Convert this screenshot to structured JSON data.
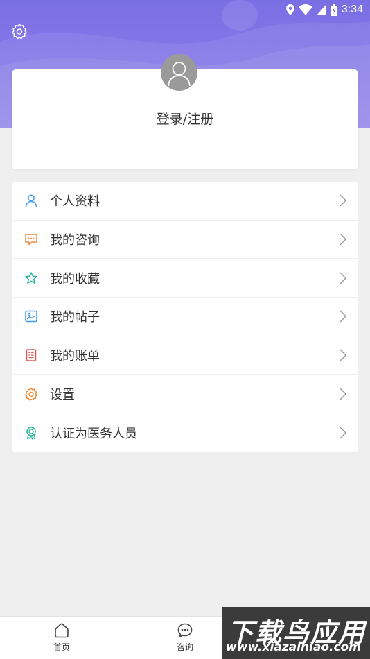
{
  "status_bar": {
    "time": "3:34"
  },
  "profile": {
    "login_label": "登录/注册"
  },
  "menu": [
    {
      "label": "个人资料",
      "icon": "person-icon",
      "color": "#3d9be9"
    },
    {
      "label": "我的咨询",
      "icon": "chat-bubble-icon",
      "color": "#f08a3a"
    },
    {
      "label": "我的收藏",
      "icon": "star-icon",
      "color": "#26b5a0"
    },
    {
      "label": "我的帖子",
      "icon": "image-post-icon",
      "color": "#3d9be9"
    },
    {
      "label": "我的账单",
      "icon": "bill-icon",
      "color": "#e2564f"
    },
    {
      "label": "设置",
      "icon": "gear-icon",
      "color": "#f08a3a"
    },
    {
      "label": "认证为医务人员",
      "icon": "certificate-icon",
      "color": "#26b5a0"
    }
  ],
  "bottom_nav": [
    {
      "label": "首页",
      "icon": "home-icon"
    },
    {
      "label": "咨询",
      "icon": "chat-icon"
    }
  ],
  "watermark": {
    "title": "下载鸟应用",
    "url": "www.xiazainiao.com"
  },
  "colors": {
    "header": "#7a6ee4",
    "background": "#efefef"
  }
}
